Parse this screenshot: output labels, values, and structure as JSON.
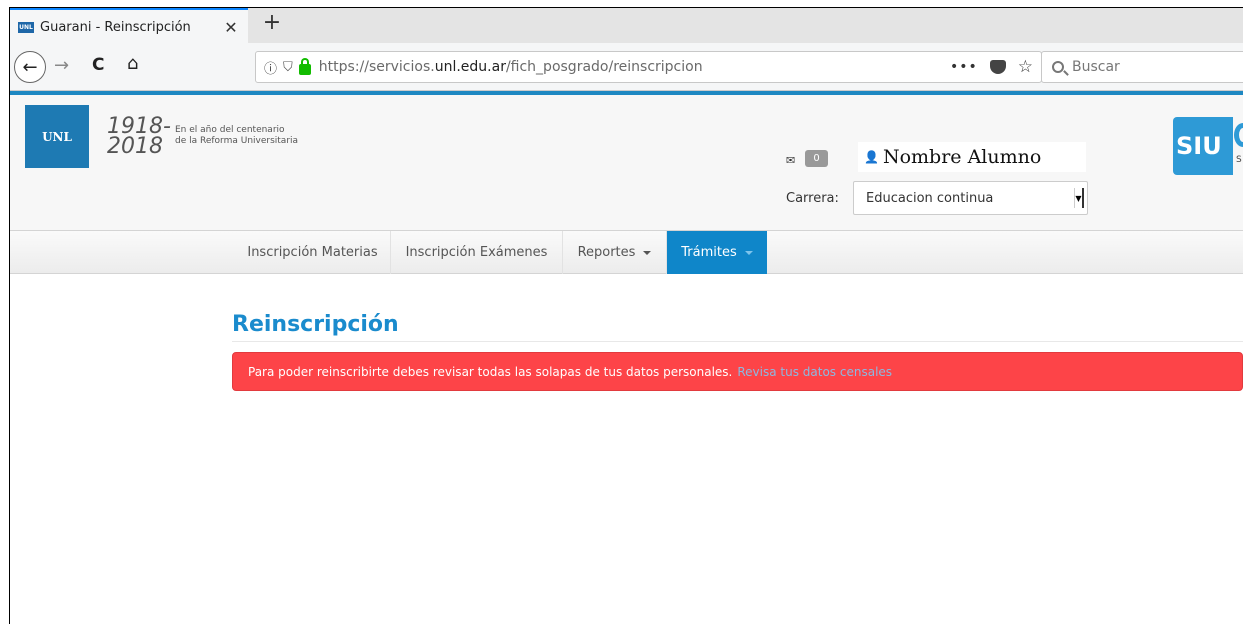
{
  "browser": {
    "tab": {
      "favicon_text": "UNL",
      "title": "Guarani - Reinscripción",
      "close": "✕"
    },
    "new_tab": "+",
    "nav": {
      "back": "←",
      "forward": "→",
      "reload": "C",
      "home": "⌂"
    },
    "url": {
      "info": "ⓘ",
      "shield": "⛉",
      "prefix": "https://servicios.",
      "domain": "unl.edu.ar",
      "path": "/fich_posgrado/reinscripcion",
      "more": "•••",
      "star": "☆"
    },
    "search": {
      "placeholder": "Buscar"
    }
  },
  "header": {
    "logo_text": "UNL",
    "year_top": "1918-",
    "year_bottom": "2018",
    "centenario_line1": "En el año del centenario",
    "centenario_line2": "de la Reforma Universitaria",
    "messages_count": "0",
    "user_name": "Nombre Alumno",
    "carrera_label": "Carrera:",
    "carrera_value": "Educacion continua",
    "siu_text": "SIU",
    "siu_sub": "S"
  },
  "menu": [
    {
      "label": "Inscripción Materias"
    },
    {
      "label": "Inscripción Exámenes"
    },
    {
      "label": "Reportes"
    },
    {
      "label": "Trámites"
    }
  ],
  "main": {
    "title": "Reinscripción",
    "alert_text": "Para poder reinscribirte debes revisar todas las solapas de tus datos personales.",
    "alert_link": "Revisa tus datos censales"
  },
  "colors": {
    "accent": "#1e88c2",
    "active_nav": "#0f86c9",
    "title": "#1a8bcd",
    "alert_bg": "#fd4448",
    "alert_link": "#8db8e0"
  }
}
